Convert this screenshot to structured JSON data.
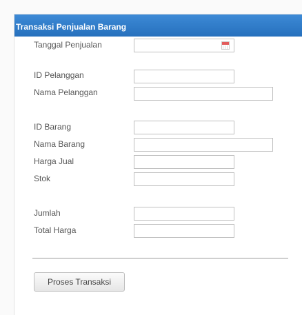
{
  "panel": {
    "title": "Transaksi Penjualan Barang"
  },
  "form": {
    "tanggal_penjualan": {
      "label": "Tanggal Penjualan",
      "value": ""
    },
    "id_pelanggan": {
      "label": "ID Pelanggan",
      "value": ""
    },
    "nama_pelanggan": {
      "label": "Nama Pelanggan",
      "value": ""
    },
    "id_barang": {
      "label": "ID Barang",
      "value": ""
    },
    "nama_barang": {
      "label": "Nama Barang",
      "value": ""
    },
    "harga_jual": {
      "label": "Harga Jual",
      "value": ""
    },
    "stok": {
      "label": "Stok",
      "value": ""
    },
    "jumlah": {
      "label": "Jumlah",
      "value": ""
    },
    "total_harga": {
      "label": "Total Harga",
      "value": ""
    }
  },
  "actions": {
    "submit_label": "Proses Transaksi"
  },
  "icons": {
    "date_picker": "calendar-icon"
  },
  "colors": {
    "header_bg": "#2f7bc7",
    "header_text": "#ffffff"
  }
}
